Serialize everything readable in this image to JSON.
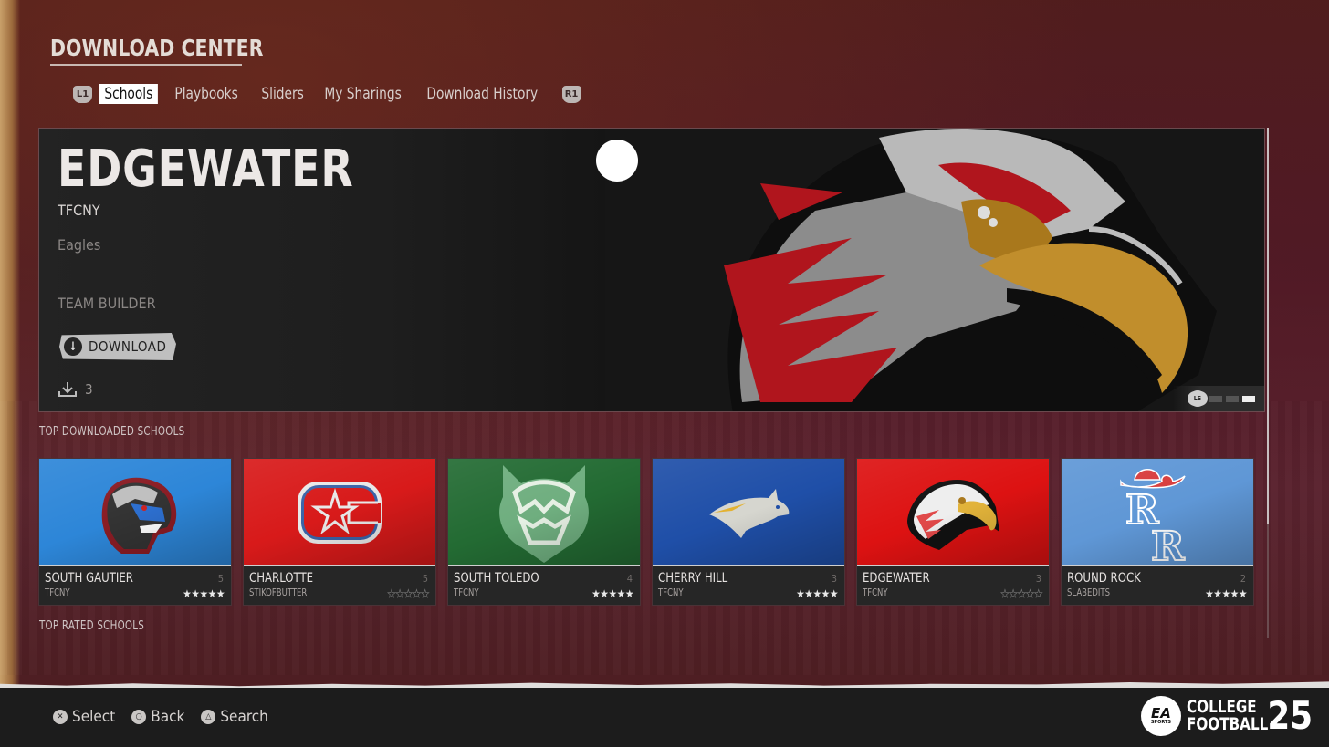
{
  "header": {
    "title": "DOWNLOAD CENTER",
    "left_bumper": "L1",
    "right_bumper": "R1",
    "tabs": [
      {
        "label": "Schools",
        "active": true
      },
      {
        "label": "Playbooks",
        "active": false
      },
      {
        "label": "Sliders",
        "active": false
      },
      {
        "label": "My Sharings",
        "active": false
      },
      {
        "label": "Download History",
        "active": false
      }
    ]
  },
  "featured": {
    "school_name": "EDGEWATER",
    "author": "TFCNY",
    "mascot": "Eagles",
    "type": "TEAM BUILDER",
    "download_label": "DOWNLOAD",
    "download_count": "3",
    "pager_stick_label": "LS",
    "pager": {
      "total": 3,
      "active_index": 2
    }
  },
  "sections": {
    "top_downloaded": "TOP DOWNLOADED SCHOOLS",
    "top_rated": "TOP RATED SCHOOLS"
  },
  "cards": [
    {
      "name": "SOUTH GAUTIER",
      "author": "TFCNY",
      "count": "5",
      "rating": 5,
      "bg": "#2d86d8",
      "logo": "tiger"
    },
    {
      "name": "CHARLOTTE",
      "author": "STIKOFBUTTER",
      "count": "5",
      "rating": 0,
      "bg": "#d81a1a",
      "logo": "c-star"
    },
    {
      "name": "SOUTH TOLEDO",
      "author": "TFCNY",
      "count": "4",
      "rating": 5,
      "bg": "#236b33",
      "logo": "wildcat"
    },
    {
      "name": "CHERRY HILL",
      "author": "TFCNY",
      "count": "3",
      "rating": 5,
      "bg": "#1f4fa8",
      "logo": "bull"
    },
    {
      "name": "EDGEWATER",
      "author": "TFCNY",
      "count": "3",
      "rating": 0,
      "bg": "#dd1212",
      "logo": "eagle"
    },
    {
      "name": "ROUND ROCK",
      "author": "SLABEDITS",
      "count": "2",
      "rating": 5,
      "bg": "#5f97d6",
      "logo": "rr"
    }
  ],
  "footer": {
    "hints": [
      {
        "icon": "cross-button-icon",
        "glyph": "✕",
        "label": "Select"
      },
      {
        "icon": "circle-button-icon",
        "glyph": "○",
        "label": "Back"
      },
      {
        "icon": "triangle-button-icon",
        "glyph": "△",
        "label": "Search"
      }
    ],
    "brand": {
      "ea": "EA",
      "sports": "SPORTS",
      "line1": "COLLEGE",
      "line2": "FOOTBALL",
      "number": "25"
    }
  },
  "colors": {
    "background": "#4a1a1f",
    "active_tab_bg": "#ffffff",
    "footer_bg": "#1c1c1c"
  }
}
